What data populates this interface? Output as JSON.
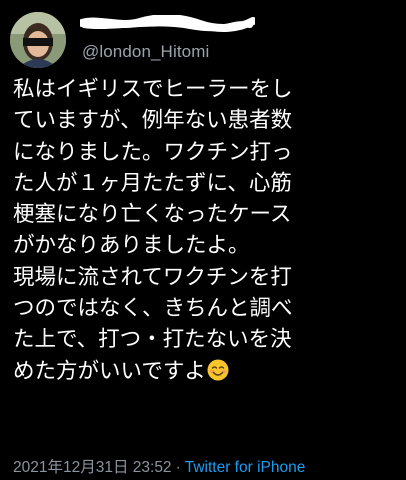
{
  "tweet": {
    "handle": "@london_Hitomi",
    "body_lines": [
      "私はイギリスでヒーラーをし",
      "ていますが、例年ない患者数",
      "になりました。ワクチン打っ",
      "た人が１ヶ月たたずに、心筋",
      "梗塞になり亡くなったケース",
      "がかなりありましたよ。",
      "現場に流されてワクチンを打",
      "つのではなく、きちんと調べ",
      "た上で、打つ・打たないを決",
      "めた方がいいですよ"
    ],
    "emoji": "smiling-face-emoji",
    "timestamp": "2021年12月31日 23:52",
    "separator": "·",
    "source": "Twitter for iPhone"
  },
  "colors": {
    "background": "#000000",
    "text": "#ffffff",
    "secondary_text": "#8b949d",
    "link": "#1d9bf0"
  }
}
